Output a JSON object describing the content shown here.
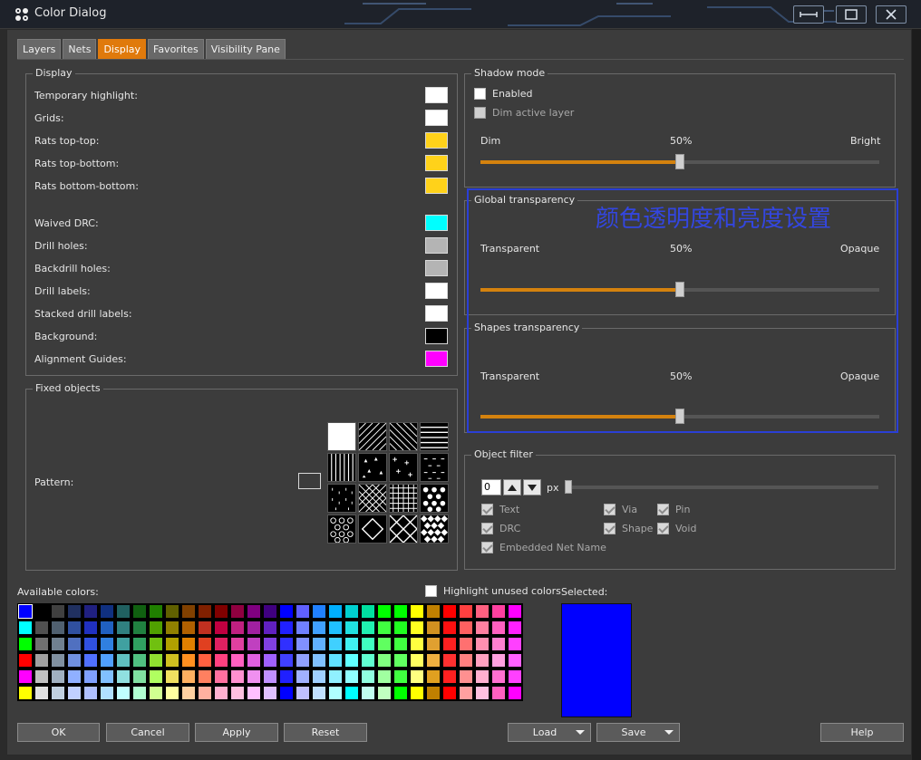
{
  "window": {
    "title": "Color Dialog",
    "icons": {
      "app": "app-logo-icon",
      "restore": "resize-horizontal-icon",
      "maximize": "maximize-icon",
      "close": "close-icon"
    }
  },
  "tabs": [
    "Layers",
    "Nets",
    "Display",
    "Favorites",
    "Visibility Pane"
  ],
  "active_tab": "Display",
  "display_group": {
    "title": "Display",
    "items": [
      {
        "label": "Temporary highlight:",
        "color": "#ffffff"
      },
      {
        "label": "Grids:",
        "color": "#ffffff"
      },
      {
        "label": "Rats top-top:",
        "color": "#ffd21a"
      },
      {
        "label": "Rats top-bottom:",
        "color": "#ffd21a"
      },
      {
        "label": "Rats bottom-bottom:",
        "color": "#ffd21a"
      },
      {
        "label": "Waived DRC:",
        "color": "#00ffff"
      },
      {
        "label": "Drill holes:",
        "color": "#b4b4b4"
      },
      {
        "label": "Backdrill holes:",
        "color": "#b4b4b4"
      },
      {
        "label": "Drill labels:",
        "color": "#ffffff"
      },
      {
        "label": "Stacked drill labels:",
        "color": "#ffffff"
      },
      {
        "label": "Background:",
        "color": "#000000"
      },
      {
        "label": "Alignment Guides:",
        "color": "#ff00ff"
      }
    ]
  },
  "fixed_objects": {
    "title": "Fixed objects",
    "pattern_label": "Pattern:",
    "pattern_color": "#ffffff"
  },
  "shadow_mode": {
    "title": "Shadow mode",
    "enabled_label": "Enabled",
    "dim_active_label": "Dim active layer",
    "min_label": "Dim",
    "mid_label": "50%",
    "max_label": "Bright",
    "value": 0.5
  },
  "global_transparency": {
    "title": "Global transparency",
    "min_label": "Transparent",
    "mid_label": "50%",
    "max_label": "Opaque",
    "value": 0.5
  },
  "shapes_transparency": {
    "title": "Shapes transparency",
    "min_label": "Transparent",
    "mid_label": "50%",
    "max_label": "Opaque",
    "value": 0.5
  },
  "annotation": "颜色透明度和亮度设置",
  "object_filter": {
    "title": "Object filter",
    "size_value": "0",
    "unit": "px",
    "checks": [
      "Text",
      "Via",
      "Pin",
      "DRC",
      "Shape",
      "Void",
      "Embedded Net Name"
    ]
  },
  "palette": {
    "available_label": "Available colors:",
    "highlight_unused_label": "Highlight unused colors",
    "selected_label": "Selected:",
    "selected_color": "#0000ff",
    "columns": [
      "#0000ff",
      "#000000",
      "#404040",
      "#203060",
      "#202080",
      "#103080",
      "#206060",
      "#106010",
      "#208000",
      "#606000",
      "#804000",
      "#802000",
      "#800000",
      "#900040",
      "#800080",
      "#400080",
      "#0000ff",
      "#6060ff",
      "#2080ff",
      "#00b0ff",
      "#00d0d0",
      "#00e0a0",
      "#00ff00",
      "#00ff00",
      "#ffff00",
      "#c08000",
      "#ff0000",
      "#ff4040",
      "#ff6080",
      "#ff40a0",
      "#ff00ff"
    ],
    "rows": [
      [
        "#0000ff",
        "#000000",
        "#404040",
        "#203060",
        "#202080",
        "#103080",
        "#206060",
        "#106010",
        "#208000",
        "#606000",
        "#804000",
        "#802000",
        "#800000",
        "#900040",
        "#800080",
        "#400080",
        "#0000ff",
        "#6060ff",
        "#2080ff",
        "#00b0ff",
        "#00d0d0",
        "#00e0a0",
        "#00ff00",
        "#00ff00",
        "#ffff00",
        "#c08000",
        "#ff0000",
        "#ff4040",
        "#ff6080",
        "#ff40a0",
        "#ff00ff"
      ],
      [
        "#00ffff",
        "#505050",
        "#506070",
        "#3050a0",
        "#2030c0",
        "#2060c0",
        "#308080",
        "#208040",
        "#50a000",
        "#908000",
        "#b06000",
        "#c03020",
        "#c00040",
        "#c02080",
        "#a020a0",
        "#6020c0",
        "#2020ff",
        "#7080ff",
        "#40a0ff",
        "#20c0ff",
        "#20e0e0",
        "#20f0b0",
        "#40ff40",
        "#20ff20",
        "#ffff20",
        "#d09020",
        "#ff1010",
        "#ff6060",
        "#ff80a0",
        "#ff60c0",
        "#ff20ff"
      ],
      [
        "#00ff00",
        "#707070",
        "#708090",
        "#5070c0",
        "#3050e0",
        "#3080e0",
        "#40a0a0",
        "#30a060",
        "#70c010",
        "#b0a000",
        "#e08000",
        "#e04020",
        "#e02060",
        "#e040a0",
        "#c040c0",
        "#8040e0",
        "#3030ff",
        "#8090ff",
        "#60b0ff",
        "#40d0ff",
        "#40f0f0",
        "#40ffc0",
        "#60ff60",
        "#40ff40",
        "#ffff40",
        "#e0a030",
        "#ff2020",
        "#ff7070",
        "#ff90b0",
        "#ff80d0",
        "#ff40ff"
      ],
      [
        "#ff0000",
        "#a0a0a0",
        "#8090a0",
        "#7090e0",
        "#5070ff",
        "#50a0ff",
        "#60c0c0",
        "#50c080",
        "#90e030",
        "#d0c020",
        "#ff9020",
        "#ff6040",
        "#ff4080",
        "#ff60c0",
        "#e060e0",
        "#a060ff",
        "#4040ff",
        "#90a0ff",
        "#80c0ff",
        "#60e0ff",
        "#60ffff",
        "#60ffd0",
        "#80ff80",
        "#60ff60",
        "#ffff60",
        "#f0b040",
        "#ff3030",
        "#ff8080",
        "#ffa0c0",
        "#ffa0e0",
        "#ff60ff"
      ],
      [
        "#ff00ff",
        "#c0c0c0",
        "#a0b0c0",
        "#90b0ff",
        "#80a0ff",
        "#80c0ff",
        "#90e0e0",
        "#80e0a0",
        "#b0ff60",
        "#f0e060",
        "#ffb060",
        "#ff8060",
        "#ff70a0",
        "#ff90d0",
        "#f090f0",
        "#c090ff",
        "#2020ff",
        "#a0b0ff",
        "#a0d0ff",
        "#90f0ff",
        "#90ffff",
        "#90ffe0",
        "#a0ffa0",
        "#40ff40",
        "#ffff80",
        "#e0a020",
        "#ff2020",
        "#ff9090",
        "#ffb0d0",
        "#ff70d0",
        "#ff40ff"
      ],
      [
        "#ffff00",
        "#e0e0e0",
        "#c0d0e0",
        "#c0d0ff",
        "#b0c0ff",
        "#b0e0ff",
        "#c0ffff",
        "#b0ffd0",
        "#d0ff90",
        "#ffffa0",
        "#ffd0a0",
        "#ffb0a0",
        "#ffb0d0",
        "#ffc0e0",
        "#ffc0ff",
        "#e0c0ff",
        "#0000ff",
        "#c0c0ff",
        "#c0e0ff",
        "#b0ffff",
        "#00ffff",
        "#c0fff0",
        "#c0ffc0",
        "#00ff00",
        "#ffff00",
        "#c08000",
        "#ff0000",
        "#ffa0a0",
        "#ffc0e0",
        "#ff60c0",
        "#ff00ff"
      ]
    ]
  },
  "buttons": {
    "ok": "OK",
    "cancel": "Cancel",
    "apply": "Apply",
    "reset": "Reset",
    "load": "Load",
    "save": "Save",
    "help": "Help"
  }
}
